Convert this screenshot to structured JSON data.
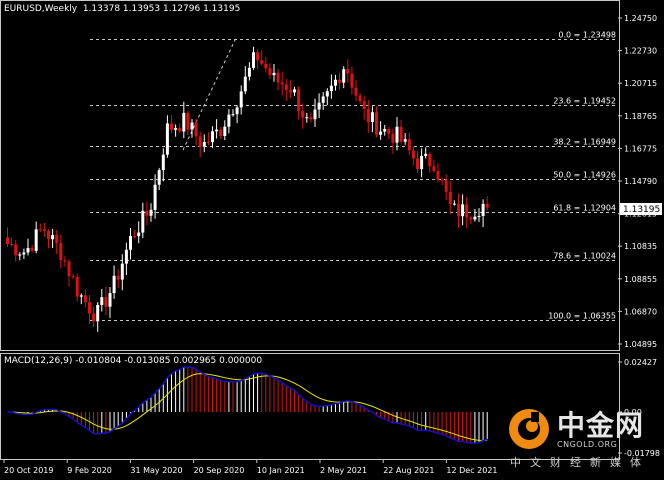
{
  "header": {
    "symbol": "EURUSD,Weekly",
    "ohlc": "1.13378 1.13953 1.12796 1.13195"
  },
  "macd": {
    "label": "MACD(12,26,9) -0.010804 -0.013085 0.002965 0.000000"
  },
  "current_price": "1.13195",
  "price_axis": [
    "1.24750",
    "1.22730",
    "1.20715",
    "1.18765",
    "1.16775",
    "1.14790",
    "1.12815",
    "1.10835",
    "1.08855",
    "1.06870",
    "1.04895"
  ],
  "macd_axis": [
    "0.02427",
    "0.00",
    "-0.01798"
  ],
  "time_axis": [
    "20 Oct 2019",
    "9 Feb 2020",
    "31 May 2020",
    "20 Sep 2020",
    "10 Jan 2021",
    "2 May 2021",
    "22 Aug 2021",
    "12 Dec 2021"
  ],
  "fib_levels": [
    {
      "label": "0.0 = 1.23498",
      "price": 1.23498
    },
    {
      "label": "23.6 = 1.19452",
      "price": 1.19452
    },
    {
      "label": "38.2 = 1.16949",
      "price": 1.16949
    },
    {
      "label": "50.0 = 1.14926",
      "price": 1.14926
    },
    {
      "label": "61.8 = 1.12904",
      "price": 1.12904
    },
    {
      "label": "78.6 = 1.10024",
      "price": 1.10024
    },
    {
      "label": "100.0 = 1.06355",
      "price": 1.06355
    }
  ],
  "watermark": {
    "brand": "中金网",
    "url": "CNGOLD.ORG",
    "sub": "中文财经新媒体"
  },
  "colors": {
    "background": "#000000",
    "bull": "#ffffff",
    "bear": "#dd1111",
    "signal": "#e8e800",
    "macd": "#1010d0",
    "grid": "#c8c8c8",
    "watermark_orange": "#f08a10"
  },
  "chart_data": {
    "type": "candlestick",
    "title": "EURUSD,Weekly",
    "ylim": [
      1.04895,
      1.2475
    ],
    "anchors": [
      {
        "time": "Oct 2019",
        "price": 1.11
      },
      {
        "time": "Nov 2019",
        "price": 1.105
      },
      {
        "time": "Dec 2019",
        "price": 1.12
      },
      {
        "time": "Jan 2020",
        "price": 1.105
      },
      {
        "time": "Feb 2020",
        "price": 1.08
      },
      {
        "time": "Mar 2020",
        "price": 1.066
      },
      {
        "time": "Apr 2020",
        "price": 1.085
      },
      {
        "time": "May 2020",
        "price": 1.115
      },
      {
        "time": "Jun 2020",
        "price": 1.13
      },
      {
        "time": "Jul 2020",
        "price": 1.18
      },
      {
        "time": "Aug 2020",
        "price": 1.185
      },
      {
        "time": "Sep 2020",
        "price": 1.17
      },
      {
        "time": "Oct 2020",
        "price": 1.18
      },
      {
        "time": "Nov 2020",
        "price": 1.2
      },
      {
        "time": "Dec 2020",
        "price": 1.225
      },
      {
        "time": "Jan 2021",
        "price": 1.21
      },
      {
        "time": "Feb 2021",
        "price": 1.205
      },
      {
        "time": "Mar 2021",
        "price": 1.18
      },
      {
        "time": "Apr 2021",
        "price": 1.2
      },
      {
        "time": "May 2021",
        "price": 1.22
      },
      {
        "time": "Jun 2021",
        "price": 1.19
      },
      {
        "time": "Jul 2021",
        "price": 1.18
      },
      {
        "time": "Aug 2021",
        "price": 1.175
      },
      {
        "time": "Sep 2021",
        "price": 1.16
      },
      {
        "time": "Oct 2021",
        "price": 1.16
      },
      {
        "time": "Nov 2021",
        "price": 1.13
      },
      {
        "time": "Dec 2021",
        "price": 1.13
      },
      {
        "time": "Jan 2022",
        "price": 1.135
      }
    ]
  }
}
